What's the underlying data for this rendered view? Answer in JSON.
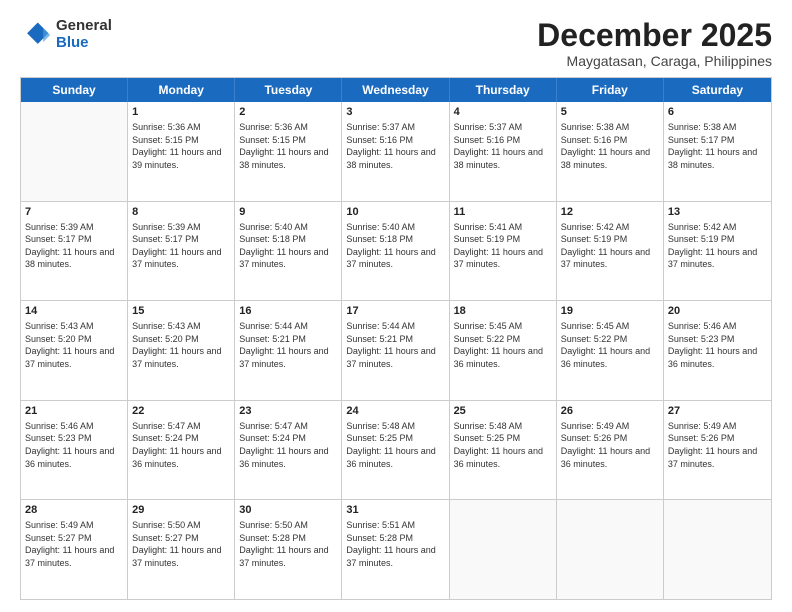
{
  "logo": {
    "general": "General",
    "blue": "Blue"
  },
  "title": "December 2025",
  "subtitle": "Maygatasan, Caraga, Philippines",
  "header": {
    "days": [
      "Sunday",
      "Monday",
      "Tuesday",
      "Wednesday",
      "Thursday",
      "Friday",
      "Saturday"
    ]
  },
  "weeks": [
    [
      {
        "day": "",
        "empty": true
      },
      {
        "day": "1",
        "sunrise": "Sunrise: 5:36 AM",
        "sunset": "Sunset: 5:15 PM",
        "daylight": "Daylight: 11 hours and 39 minutes."
      },
      {
        "day": "2",
        "sunrise": "Sunrise: 5:36 AM",
        "sunset": "Sunset: 5:15 PM",
        "daylight": "Daylight: 11 hours and 38 minutes."
      },
      {
        "day": "3",
        "sunrise": "Sunrise: 5:37 AM",
        "sunset": "Sunset: 5:16 PM",
        "daylight": "Daylight: 11 hours and 38 minutes."
      },
      {
        "day": "4",
        "sunrise": "Sunrise: 5:37 AM",
        "sunset": "Sunset: 5:16 PM",
        "daylight": "Daylight: 11 hours and 38 minutes."
      },
      {
        "day": "5",
        "sunrise": "Sunrise: 5:38 AM",
        "sunset": "Sunset: 5:16 PM",
        "daylight": "Daylight: 11 hours and 38 minutes."
      },
      {
        "day": "6",
        "sunrise": "Sunrise: 5:38 AM",
        "sunset": "Sunset: 5:17 PM",
        "daylight": "Daylight: 11 hours and 38 minutes."
      }
    ],
    [
      {
        "day": "7",
        "sunrise": "Sunrise: 5:39 AM",
        "sunset": "Sunset: 5:17 PM",
        "daylight": "Daylight: 11 hours and 38 minutes."
      },
      {
        "day": "8",
        "sunrise": "Sunrise: 5:39 AM",
        "sunset": "Sunset: 5:17 PM",
        "daylight": "Daylight: 11 hours and 37 minutes."
      },
      {
        "day": "9",
        "sunrise": "Sunrise: 5:40 AM",
        "sunset": "Sunset: 5:18 PM",
        "daylight": "Daylight: 11 hours and 37 minutes."
      },
      {
        "day": "10",
        "sunrise": "Sunrise: 5:40 AM",
        "sunset": "Sunset: 5:18 PM",
        "daylight": "Daylight: 11 hours and 37 minutes."
      },
      {
        "day": "11",
        "sunrise": "Sunrise: 5:41 AM",
        "sunset": "Sunset: 5:19 PM",
        "daylight": "Daylight: 11 hours and 37 minutes."
      },
      {
        "day": "12",
        "sunrise": "Sunrise: 5:42 AM",
        "sunset": "Sunset: 5:19 PM",
        "daylight": "Daylight: 11 hours and 37 minutes."
      },
      {
        "day": "13",
        "sunrise": "Sunrise: 5:42 AM",
        "sunset": "Sunset: 5:19 PM",
        "daylight": "Daylight: 11 hours and 37 minutes."
      }
    ],
    [
      {
        "day": "14",
        "sunrise": "Sunrise: 5:43 AM",
        "sunset": "Sunset: 5:20 PM",
        "daylight": "Daylight: 11 hours and 37 minutes."
      },
      {
        "day": "15",
        "sunrise": "Sunrise: 5:43 AM",
        "sunset": "Sunset: 5:20 PM",
        "daylight": "Daylight: 11 hours and 37 minutes."
      },
      {
        "day": "16",
        "sunrise": "Sunrise: 5:44 AM",
        "sunset": "Sunset: 5:21 PM",
        "daylight": "Daylight: 11 hours and 37 minutes."
      },
      {
        "day": "17",
        "sunrise": "Sunrise: 5:44 AM",
        "sunset": "Sunset: 5:21 PM",
        "daylight": "Daylight: 11 hours and 37 minutes."
      },
      {
        "day": "18",
        "sunrise": "Sunrise: 5:45 AM",
        "sunset": "Sunset: 5:22 PM",
        "daylight": "Daylight: 11 hours and 36 minutes."
      },
      {
        "day": "19",
        "sunrise": "Sunrise: 5:45 AM",
        "sunset": "Sunset: 5:22 PM",
        "daylight": "Daylight: 11 hours and 36 minutes."
      },
      {
        "day": "20",
        "sunrise": "Sunrise: 5:46 AM",
        "sunset": "Sunset: 5:23 PM",
        "daylight": "Daylight: 11 hours and 36 minutes."
      }
    ],
    [
      {
        "day": "21",
        "sunrise": "Sunrise: 5:46 AM",
        "sunset": "Sunset: 5:23 PM",
        "daylight": "Daylight: 11 hours and 36 minutes."
      },
      {
        "day": "22",
        "sunrise": "Sunrise: 5:47 AM",
        "sunset": "Sunset: 5:24 PM",
        "daylight": "Daylight: 11 hours and 36 minutes."
      },
      {
        "day": "23",
        "sunrise": "Sunrise: 5:47 AM",
        "sunset": "Sunset: 5:24 PM",
        "daylight": "Daylight: 11 hours and 36 minutes."
      },
      {
        "day": "24",
        "sunrise": "Sunrise: 5:48 AM",
        "sunset": "Sunset: 5:25 PM",
        "daylight": "Daylight: 11 hours and 36 minutes."
      },
      {
        "day": "25",
        "sunrise": "Sunrise: 5:48 AM",
        "sunset": "Sunset: 5:25 PM",
        "daylight": "Daylight: 11 hours and 36 minutes."
      },
      {
        "day": "26",
        "sunrise": "Sunrise: 5:49 AM",
        "sunset": "Sunset: 5:26 PM",
        "daylight": "Daylight: 11 hours and 36 minutes."
      },
      {
        "day": "27",
        "sunrise": "Sunrise: 5:49 AM",
        "sunset": "Sunset: 5:26 PM",
        "daylight": "Daylight: 11 hours and 37 minutes."
      }
    ],
    [
      {
        "day": "28",
        "sunrise": "Sunrise: 5:49 AM",
        "sunset": "Sunset: 5:27 PM",
        "daylight": "Daylight: 11 hours and 37 minutes."
      },
      {
        "day": "29",
        "sunrise": "Sunrise: 5:50 AM",
        "sunset": "Sunset: 5:27 PM",
        "daylight": "Daylight: 11 hours and 37 minutes."
      },
      {
        "day": "30",
        "sunrise": "Sunrise: 5:50 AM",
        "sunset": "Sunset: 5:28 PM",
        "daylight": "Daylight: 11 hours and 37 minutes."
      },
      {
        "day": "31",
        "sunrise": "Sunrise: 5:51 AM",
        "sunset": "Sunset: 5:28 PM",
        "daylight": "Daylight: 11 hours and 37 minutes."
      },
      {
        "day": "",
        "empty": true
      },
      {
        "day": "",
        "empty": true
      },
      {
        "day": "",
        "empty": true
      }
    ]
  ]
}
